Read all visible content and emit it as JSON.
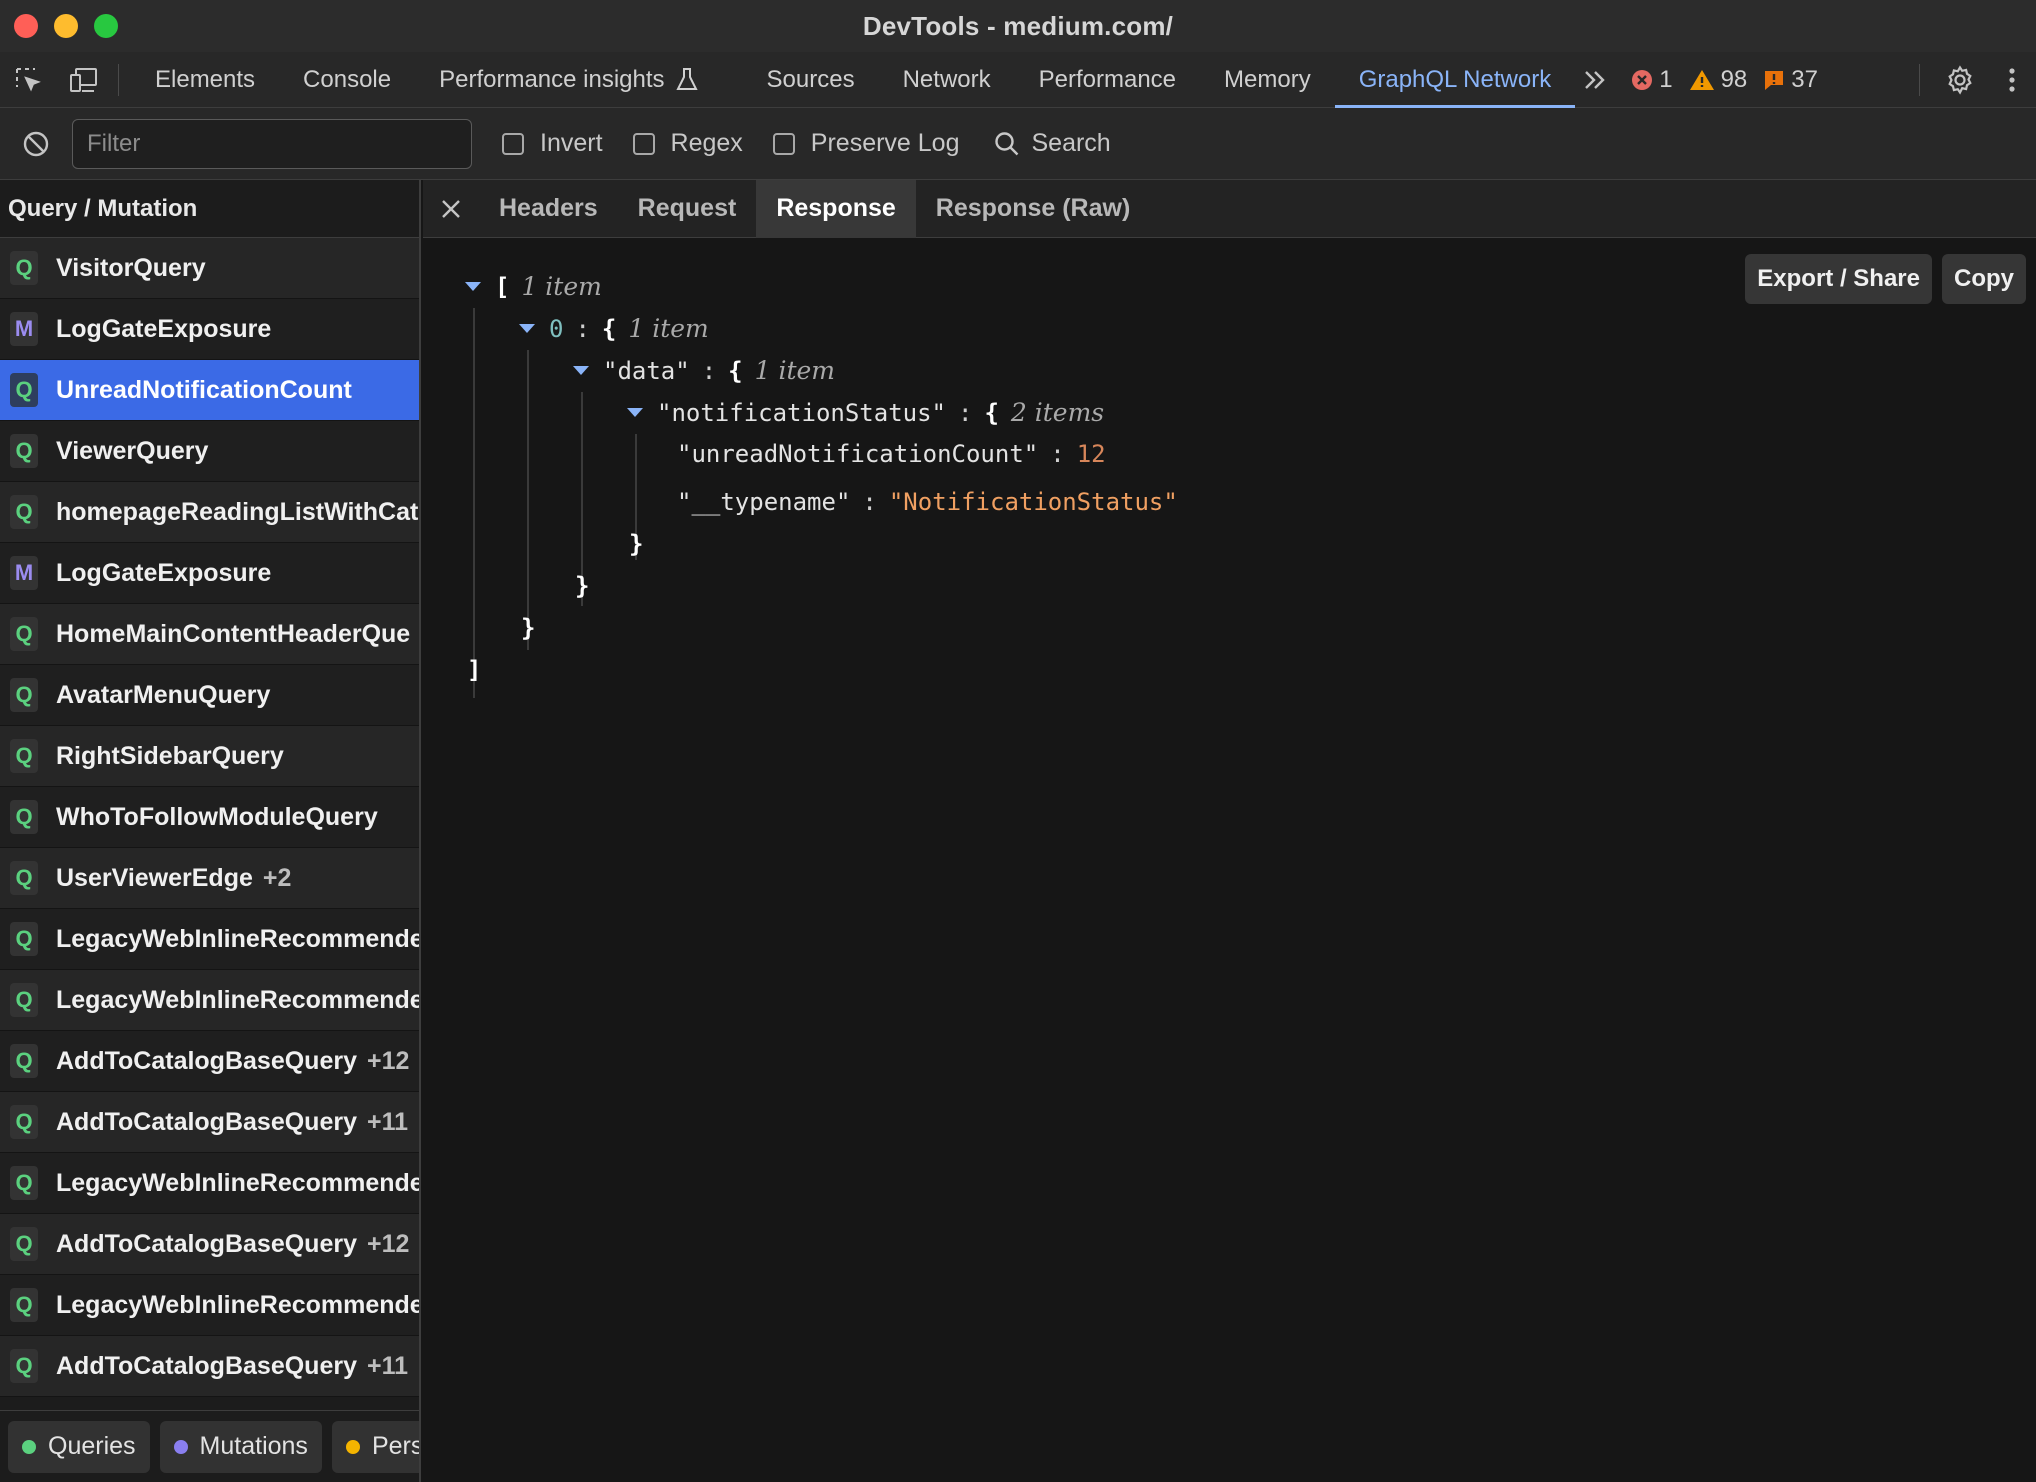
{
  "window": {
    "title": "DevTools - medium.com/"
  },
  "main_tabs": [
    {
      "label": "Elements"
    },
    {
      "label": "Console"
    },
    {
      "label": "Performance insights"
    },
    {
      "label": "Sources"
    },
    {
      "label": "Network"
    },
    {
      "label": "Performance"
    },
    {
      "label": "Memory"
    },
    {
      "label": "GraphQL Network"
    }
  ],
  "active_main_tab": "GraphQL Network",
  "status_counts": {
    "errors": "1",
    "warnings": "98",
    "issues": "37"
  },
  "filterbar": {
    "filter_placeholder": "Filter",
    "filter_value": "",
    "invert_label": "Invert",
    "regex_label": "Regex",
    "preserve_log_label": "Preserve Log",
    "search_label": "Search"
  },
  "operations": {
    "header": "Query / Mutation",
    "items": [
      {
        "type": "Q",
        "name": "VisitorQuery",
        "count": ""
      },
      {
        "type": "M",
        "name": "LogGateExposure",
        "count": ""
      },
      {
        "type": "Q",
        "name": "UnreadNotificationCount",
        "count": "",
        "selected": true
      },
      {
        "type": "Q",
        "name": "ViewerQuery",
        "count": ""
      },
      {
        "type": "Q",
        "name": "homepageReadingListWithCat",
        "count": ""
      },
      {
        "type": "M",
        "name": "LogGateExposure",
        "count": ""
      },
      {
        "type": "Q",
        "name": "HomeMainContentHeaderQue",
        "count": ""
      },
      {
        "type": "Q",
        "name": "AvatarMenuQuery",
        "count": ""
      },
      {
        "type": "Q",
        "name": "RightSidebarQuery",
        "count": ""
      },
      {
        "type": "Q",
        "name": "WhoToFollowModuleQuery",
        "count": ""
      },
      {
        "type": "Q",
        "name": "UserViewerEdge",
        "count": "+2"
      },
      {
        "type": "Q",
        "name": "LegacyWebInlineRecommende",
        "count": ""
      },
      {
        "type": "Q",
        "name": "LegacyWebInlineRecommende",
        "count": ""
      },
      {
        "type": "Q",
        "name": "AddToCatalogBaseQuery",
        "count": "+12"
      },
      {
        "type": "Q",
        "name": "AddToCatalogBaseQuery",
        "count": "+11"
      },
      {
        "type": "Q",
        "name": "LegacyWebInlineRecommende",
        "count": ""
      },
      {
        "type": "Q",
        "name": "AddToCatalogBaseQuery",
        "count": "+12"
      },
      {
        "type": "Q",
        "name": "LegacyWebInlineRecommende",
        "count": ""
      },
      {
        "type": "Q",
        "name": "AddToCatalogBaseQuery",
        "count": "+11"
      }
    ]
  },
  "legend": [
    {
      "label": "Queries",
      "color": "#5bd17f"
    },
    {
      "label": "Mutations",
      "color": "#8a7ff0"
    },
    {
      "label": "Pers",
      "color": "#f4b400"
    }
  ],
  "detail_tabs": [
    {
      "label": "Headers"
    },
    {
      "label": "Request"
    },
    {
      "label": "Response"
    },
    {
      "label": "Response (Raw)"
    }
  ],
  "active_detail_tab": "Response",
  "actions": {
    "export_label": "Export / Share",
    "copy_label": "Copy"
  },
  "response": {
    "root_open": "[",
    "root_count": "1 item",
    "item0_index": "0",
    "item0_count": "1 item",
    "data_key": "\"data\"",
    "data_count": "1 item",
    "status_key": "\"notificationStatus\"",
    "status_count": "2 items",
    "unread_key": "\"unreadNotificationCount\"",
    "unread_value": "12",
    "typename_key": "\"__typename\"",
    "typename_value": "\"NotificationStatus\"",
    "root_close": "]"
  },
  "colors": {
    "accent": "#8ab4f8",
    "selected_row": "#3b6ae6",
    "query_badge": "#5bd17f",
    "mutation_badge": "#9b8cf0",
    "error": "#e46962",
    "warning": "#f29900",
    "issue": "#e8710a",
    "json_number": "#d7865a",
    "json_string": "#f0a062"
  }
}
